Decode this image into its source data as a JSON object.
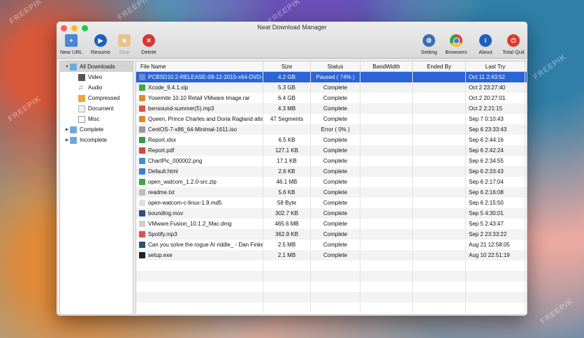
{
  "window": {
    "title": "Neat Download Manager"
  },
  "watermark": "FREEPIK",
  "toolbar": {
    "new_url": "New URL",
    "resume": "Resume",
    "stop": "Stop",
    "delete": "Delete",
    "setting": "Setting",
    "browsers": "Browsers",
    "about": "About",
    "total_quit": "Total Quit"
  },
  "sidebar": {
    "all": "All Downloads",
    "video": "Video",
    "audio": "Audio",
    "compressed": "Compressed",
    "document": "Document",
    "misc": "Misc",
    "complete": "Complete",
    "incomplete": "Incomplete"
  },
  "columns": {
    "name": "File Name",
    "size": "Size",
    "status": "Status",
    "bandwidth": "BandWidth",
    "ended_by": "Ended By",
    "last_try": "Last Try"
  },
  "rows": [
    {
      "name": "PCBSD10.2-RELEASE-09-12-2015-x64-DVD-USB.iso",
      "size": "4.2 GB",
      "status": "Paused ( 74% )",
      "last": "Oct 11   2:43:52",
      "icon": "#6a8fd0",
      "selected": true
    },
    {
      "name": "Xcode_9.4.1.xip",
      "size": "5.3 GB",
      "status": "Complete",
      "last": "Oct 2   23:27:40",
      "icon": "#3aa845"
    },
    {
      "name": "Yosemite 10.10 Retail VMware Image.rar",
      "size": "6.4 GB",
      "status": "Complete",
      "last": "Oct 2   20:27:01",
      "icon": "#e38a2a"
    },
    {
      "name": "bensound-summer(5).mp3",
      "size": "4.3 MB",
      "status": "Complete",
      "last": "Oct 2   2:21:15",
      "icon": "#d9534f"
    },
    {
      "name": "Queen, Prince Charles and Doria Ragland attend",
      "size": "47 Segments",
      "status": "Complete",
      "last": "Sep 7   0:10:43",
      "icon": "#e38a2a"
    },
    {
      "name": "CentOS-7-x86_64-Minimal-1611.iso",
      "size": "",
      "status": "Error ( 0% )",
      "last": "Sep 6   23:33:43",
      "icon": "#9a9a9a"
    },
    {
      "name": "Report.xlsx",
      "size": "6.5 KB",
      "status": "Complete",
      "last": "Sep 6   2:44:16",
      "icon": "#2f9e4f"
    },
    {
      "name": "Report.pdf",
      "size": "127.1 KB",
      "status": "Complete",
      "last": "Sep 6   2:42:24",
      "icon": "#d64541"
    },
    {
      "name": "ChartPic_000002.png",
      "size": "17.1 KB",
      "status": "Complete",
      "last": "Sep 6   2:34:55",
      "icon": "#4a8cc9"
    },
    {
      "name": "Default.html",
      "size": "2.6 KB",
      "status": "Complete",
      "last": "Sep 6   2:33:43",
      "icon": "#3d7fd1"
    },
    {
      "name": "open_watcom_1.2.0-src.zip",
      "size": "46.1 MB",
      "status": "Complete",
      "last": "Sep 6   2:17:04",
      "icon": "#3aa845"
    },
    {
      "name": "readme.txt",
      "size": "5.6 KB",
      "status": "Complete",
      "last": "Sep 6   2:16:08",
      "icon": "#bdbdbd"
    },
    {
      "name": "open-watcom-c-linux-1.9.md5",
      "size": "58 Byte",
      "status": "Complete",
      "last": "Sep 6   2:15:50",
      "icon": "#e0e0e0"
    },
    {
      "name": "bounding.mov",
      "size": "302.7 KB",
      "status": "Complete",
      "last": "Sep 5   4:30:01",
      "icon": "#2d4f7a"
    },
    {
      "name": "VMware.Fusion_10.1.2_Mac.dmg",
      "size": "465.6 MB",
      "status": "Complete",
      "last": "Sep 5   2:43:47",
      "icon": "#cfcfcf"
    },
    {
      "name": "Spotify.mp3",
      "size": "362.9 KB",
      "status": "Complete",
      "last": "Sep 2   23:33:22",
      "icon": "#d9534f"
    },
    {
      "name": "Can you solve the rogue AI riddle_ - Dan Finkel",
      "size": "2.5 MB",
      "status": "Complete",
      "last": "Aug 21   12:58:05",
      "icon": "#2d4f7a"
    },
    {
      "name": "setup.exe",
      "size": "2.1 MB",
      "status": "Complete",
      "last": "Aug 10   22:51:19",
      "icon": "#222222"
    }
  ],
  "empty_rows": 5
}
